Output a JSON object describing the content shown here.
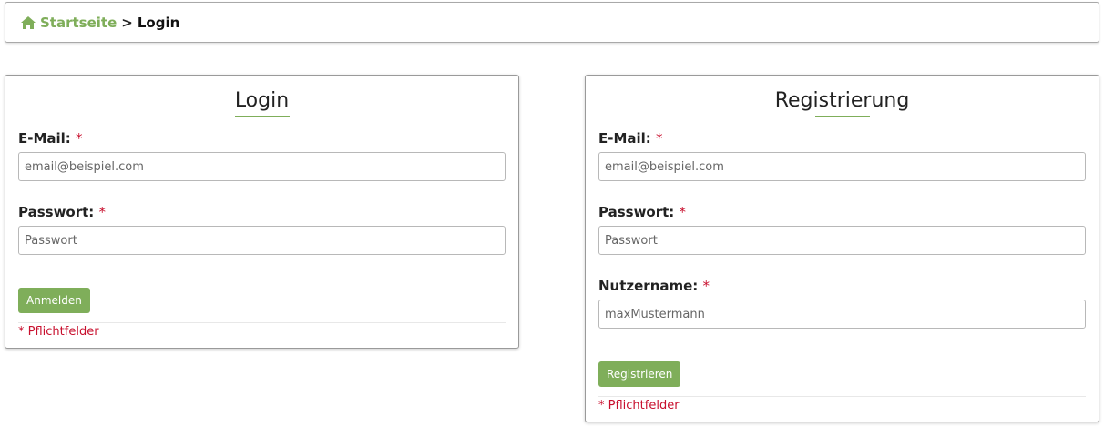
{
  "breadcrumb": {
    "home_label": "Startseite",
    "separator": ">",
    "current": "Login"
  },
  "colors": {
    "accent": "#7fae5a",
    "required": "#c8102e"
  },
  "login": {
    "title": "Login",
    "email_label": "E-Mail:",
    "email_placeholder": "email@beispiel.com",
    "password_label": "Passwort:",
    "password_placeholder": "Passwort",
    "submit_label": "Anmelden",
    "required_note": "* Pflichtfelder",
    "required_marker": "*"
  },
  "register": {
    "title": "Registrierung",
    "email_label": "E-Mail:",
    "email_placeholder": "email@beispiel.com",
    "password_label": "Passwort:",
    "password_placeholder": "Passwort",
    "username_label": "Nutzername:",
    "username_placeholder": "maxMustermann",
    "submit_label": "Registrieren",
    "required_note": "* Pflichtfelder",
    "required_marker": "*"
  },
  "icons": {
    "home": "home-icon"
  }
}
